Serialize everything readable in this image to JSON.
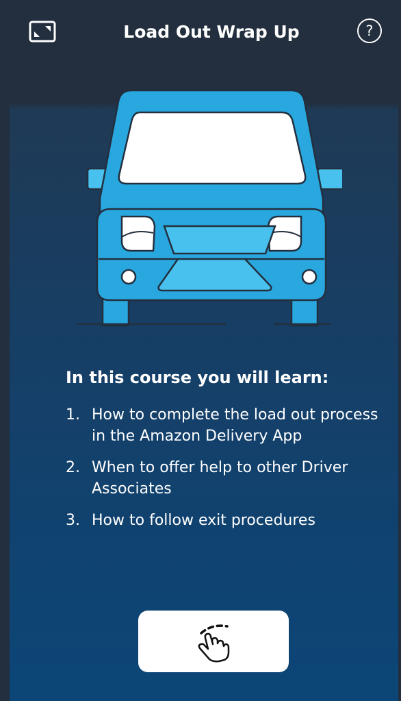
{
  "header": {
    "title": "Load Out Wrap Up",
    "help_label": "?",
    "expand_icon": "expand-icon"
  },
  "content": {
    "heading": "In this course you will learn:",
    "items": [
      {
        "number": "1.",
        "text": "How to complete the load out process in the Amazon Delivery App"
      },
      {
        "number": "2.",
        "text": "When to offer help to other Driver Associates"
      },
      {
        "number": "3.",
        "text": "How to follow exit procedures"
      }
    ]
  },
  "actions": {
    "continue_icon": "tap-swipe-icon"
  },
  "colors": {
    "background_top": "#232f3e",
    "background_bottom": "#0b4677",
    "van_body": "#29a8e0",
    "van_light": "#48c1ee",
    "outline": "#232f3e",
    "text": "#ffffff"
  }
}
